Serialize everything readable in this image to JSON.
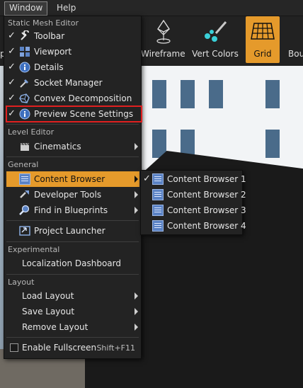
{
  "menubar": {
    "window": "Window",
    "help": "Help"
  },
  "toolbar": {
    "wireframe": "Wireframe",
    "vertcolors": "Vert Colors",
    "grid": "Grid",
    "bounds": "Bou",
    "left_clip": "p"
  },
  "window_menu": {
    "static_mesh_editor": "Static Mesh Editor",
    "toolbar": "Toolbar",
    "viewport": "Viewport",
    "details": "Details",
    "socket_manager": "Socket Manager",
    "convex_decomposition": "Convex Decomposition",
    "preview_scene_settings": "Preview Scene Settings",
    "level_editor": "Level Editor",
    "cinematics": "Cinematics",
    "general": "General",
    "content_browser": "Content Browser",
    "developer_tools": "Developer Tools",
    "find_in_blueprints": "Find in Blueprints",
    "project_launcher": "Project Launcher",
    "experimental": "Experimental",
    "localization_dashboard": "Localization Dashboard",
    "layout": "Layout",
    "load_layout": "Load Layout",
    "save_layout": "Save Layout",
    "remove_layout": "Remove Layout",
    "enable_fullscreen": "Enable Fullscreen",
    "fullscreen_shortcut": "Shift+F11",
    "check": "✓"
  },
  "content_browser_submenu": {
    "cb1": "Content Browser 1",
    "cb2": "Content Browser 2",
    "cb3": "Content Browser 3",
    "cb4": "Content Browser 4",
    "check": "✓"
  },
  "colors": {
    "highlight": "#e59a2b",
    "annotation": "#e02020",
    "menu_bg": "#232323"
  }
}
